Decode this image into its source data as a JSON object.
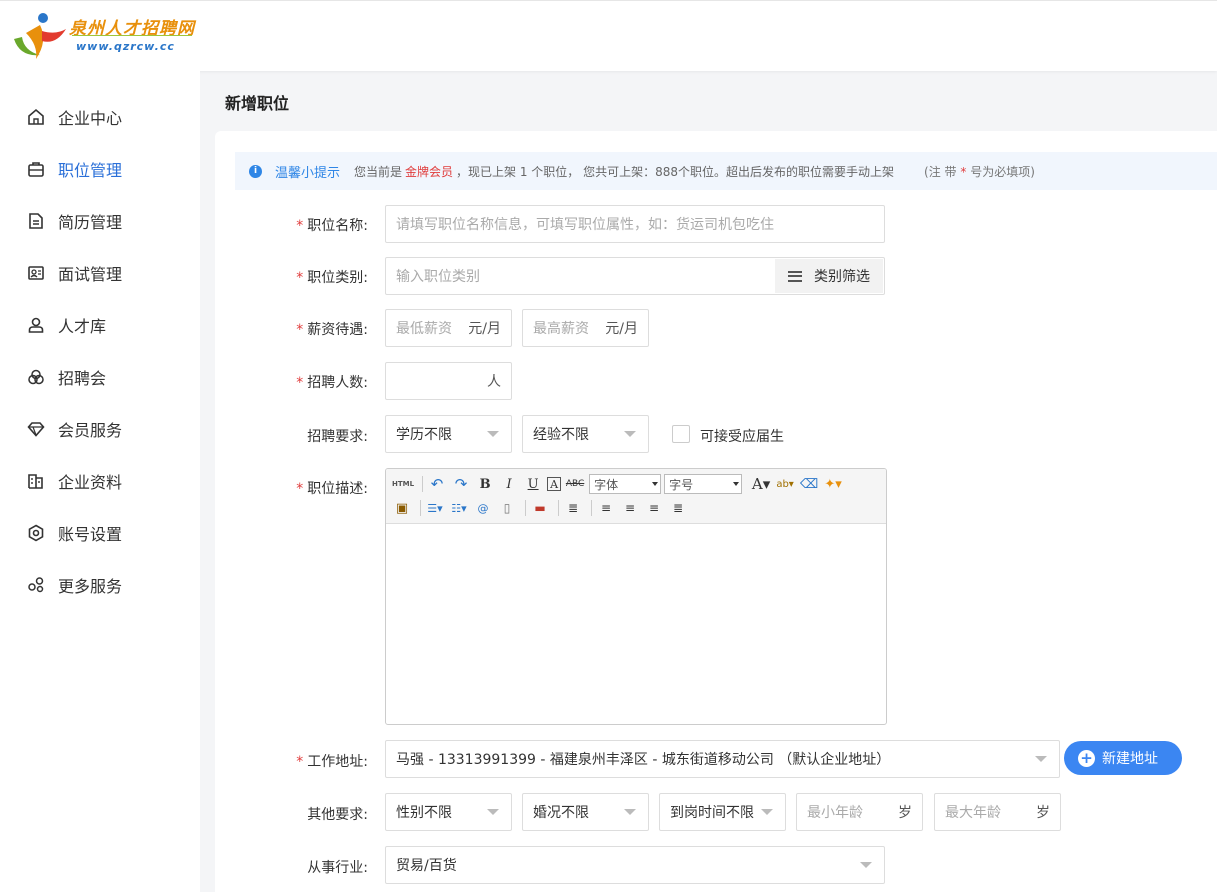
{
  "logo": {
    "name": "泉州人才招聘网",
    "url": "www.qzrcw.cc"
  },
  "sidebar": {
    "items": [
      {
        "label": "企业中心",
        "icon": "home-icon"
      },
      {
        "label": "职位管理",
        "icon": "briefcase-icon",
        "active": true
      },
      {
        "label": "简历管理",
        "icon": "document-icon"
      },
      {
        "label": "面试管理",
        "icon": "id-card-icon"
      },
      {
        "label": "人才库",
        "icon": "user-icon"
      },
      {
        "label": "招聘会",
        "icon": "rings-icon"
      },
      {
        "label": "会员服务",
        "icon": "diamond-icon"
      },
      {
        "label": "企业资料",
        "icon": "building-icon"
      },
      {
        "label": "账号设置",
        "icon": "gear-icon"
      },
      {
        "label": "更多服务",
        "icon": "apps-icon"
      }
    ]
  },
  "page": {
    "title": "新增职位"
  },
  "tip": {
    "title": "温馨小提示",
    "text_before": "您当前是",
    "member_level": "金牌会员",
    "text_after": "，现已上架 1 个职位， 您共可上架：888个职位。超出后发布的职位需要手动上架",
    "note_prefix": "(注 带",
    "note_star": "*",
    "note_suffix": "号为必填项)"
  },
  "form": {
    "job_name": {
      "label": "职位名称:",
      "placeholder": "请填写职位名称信息，可填写职位属性，如：货运司机包吃住"
    },
    "job_category": {
      "label": "职位类别:",
      "placeholder": "输入职位类别",
      "button": "类别筛选"
    },
    "salary": {
      "label": "薪资待遇:",
      "min_placeholder": "最低薪资",
      "max_placeholder": "最高薪资",
      "unit": "元/月"
    },
    "headcount": {
      "label": "招聘人数:",
      "unit": "人"
    },
    "requirements": {
      "label": "招聘要求:",
      "education": "学历不限",
      "experience": "经验不限",
      "accept_graduates": "可接受应届生"
    },
    "description": {
      "label": "职位描述:",
      "font_select": "字体",
      "size_select": "字号"
    },
    "work_address": {
      "label": "工作地址:",
      "value": "马强 - 13313991399 - 福建泉州丰泽区 - 城东街道移动公司 （默认企业地址）",
      "add_button": "新建地址"
    },
    "other": {
      "label": "其他要求:",
      "gender": "性别不限",
      "marital": "婚况不限",
      "arrival": "到岗时间不限",
      "min_age": "最小年龄",
      "max_age": "最大年龄",
      "age_unit": "岁"
    },
    "industry": {
      "label": "从事行业:",
      "value": "贸易/百货"
    }
  },
  "colors": {
    "accent": "#2a6fd8",
    "required": "#e03c3c",
    "button": "#3b86f2"
  }
}
